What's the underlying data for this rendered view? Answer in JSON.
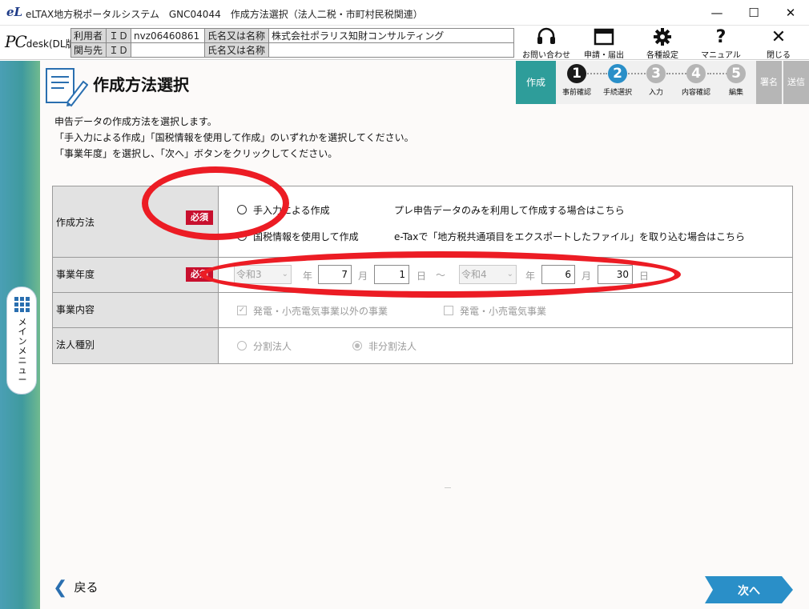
{
  "window": {
    "title": "eLTAX地方税ポータルシステム　GNC04044　作成方法選択（法人二税・市町村民税関連）",
    "logo_glyph": "eL",
    "minimize_glyph": "—",
    "maximize_glyph": "☐",
    "close_glyph": "✕"
  },
  "header": {
    "brand": "PC",
    "brand_rest": "desk",
    "brand_sub": "(DL版)",
    "user_label": "利用者",
    "related_label": "関与先",
    "id_label": "ＩＤ",
    "user_id": "nvz06460861",
    "related_id": "",
    "name_label": "氏名又は名称",
    "user_name": "株式会社ポラリス知財コンサルティング",
    "related_name": ""
  },
  "toolbar": [
    {
      "key": "contact",
      "label": "お問い合わせ",
      "icon": "headset-icon"
    },
    {
      "key": "apply",
      "label": "申請・届出",
      "icon": "window-icon"
    },
    {
      "key": "settings",
      "label": "各種設定",
      "icon": "gear-icon"
    },
    {
      "key": "manual",
      "label": "マニュアル",
      "icon": "question-icon"
    },
    {
      "key": "close",
      "label": "閉じる",
      "icon": "close-x-icon"
    }
  ],
  "toolbar_glyphs": {
    "question": "?",
    "close": "✕"
  },
  "sidebar": {
    "menu_label": "メインメニュー"
  },
  "page": {
    "title": "作成方法選択"
  },
  "steps": {
    "current_section": "作成",
    "items": [
      {
        "num": "1",
        "label": "事前確認",
        "color": "#1a1a1a"
      },
      {
        "num": "2",
        "label": "手続選択",
        "color": "#2a8fc8"
      },
      {
        "num": "3",
        "label": "入力",
        "color": "#b5b5b5"
      },
      {
        "num": "4",
        "label": "内容確認",
        "color": "#b5b5b5"
      },
      {
        "num": "5",
        "label": "編集",
        "color": "#b5b5b5"
      }
    ],
    "sign_label": "署名",
    "send_label": "送信"
  },
  "instructions": [
    "申告データの作成方法を選択します。",
    "「手入力による作成」「国税情報を使用して作成」のいずれかを選択してください。",
    "「事業年度」を選択し、「次へ」ボタンをクリックしてください。"
  ],
  "form": {
    "required_label": "必須",
    "method": {
      "label": "作成方法",
      "options": [
        {
          "label": "手入力による作成",
          "desc": "プレ申告データのみを利用して作成する場合はこちら"
        },
        {
          "label": "国税情報を使用して作成",
          "desc": "e-Taxで「地方税共通項目をエクスポートしたファイル」を取り込む場合はこちら"
        }
      ]
    },
    "fiscal_year": {
      "label": "事業年度",
      "from_era": "令和3",
      "from_month": "7",
      "from_day": "1",
      "to_era": "令和4",
      "to_month": "6",
      "to_day": "30",
      "year_unit": "年",
      "month_unit": "月",
      "day_unit": "日",
      "separator": "～"
    },
    "business": {
      "label": "事業内容",
      "options": [
        {
          "label": "発電・小売電気事業以外の事業",
          "checked": true
        },
        {
          "label": "発電・小売電気事業",
          "checked": false
        }
      ]
    },
    "corp_type": {
      "label": "法人種別",
      "options": [
        {
          "label": "分割法人",
          "selected": false
        },
        {
          "label": "非分割法人",
          "selected": true
        }
      ]
    }
  },
  "nav": {
    "back_label": "戻る",
    "next_label": "次へ"
  },
  "annotation_color": "#ec1c24",
  "accent_color": "#2e9d9a"
}
